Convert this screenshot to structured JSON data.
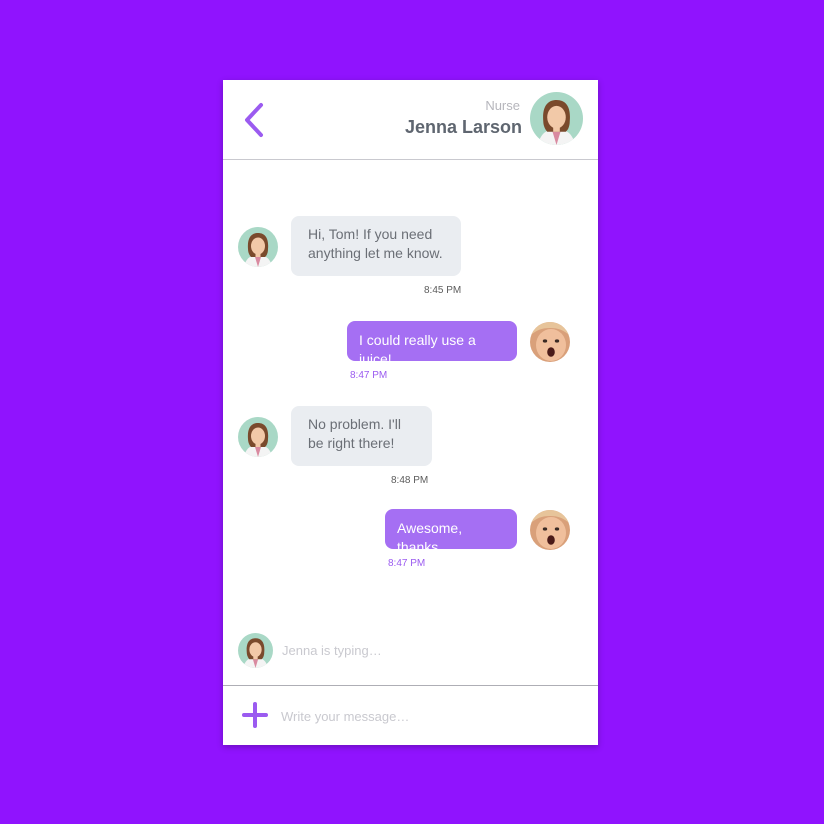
{
  "header": {
    "role": "Nurse",
    "name": "Jenna Larson"
  },
  "messages": [
    {
      "from": "nurse",
      "text": "Hi, Tom! If you need anything let me know.",
      "time": "8:45 PM"
    },
    {
      "from": "user",
      "text": "I could really use a juice!",
      "time": "8:47 PM"
    },
    {
      "from": "nurse",
      "text": "No problem. I'll be right there!",
      "time": "8:48 PM"
    },
    {
      "from": "user",
      "text": "Awesome, thanks",
      "time": "8:47 PM"
    }
  ],
  "typing": "Jenna is typing…",
  "composer": {
    "placeholder": "Write your message…"
  },
  "colors": {
    "background": "#9013fe",
    "accent": "#9b5bf0",
    "outgoing_bubble": "#a56ff3",
    "incoming_bubble": "#eaedf1"
  },
  "icons": {
    "back": "chevron-left-icon",
    "add": "plus-icon"
  }
}
